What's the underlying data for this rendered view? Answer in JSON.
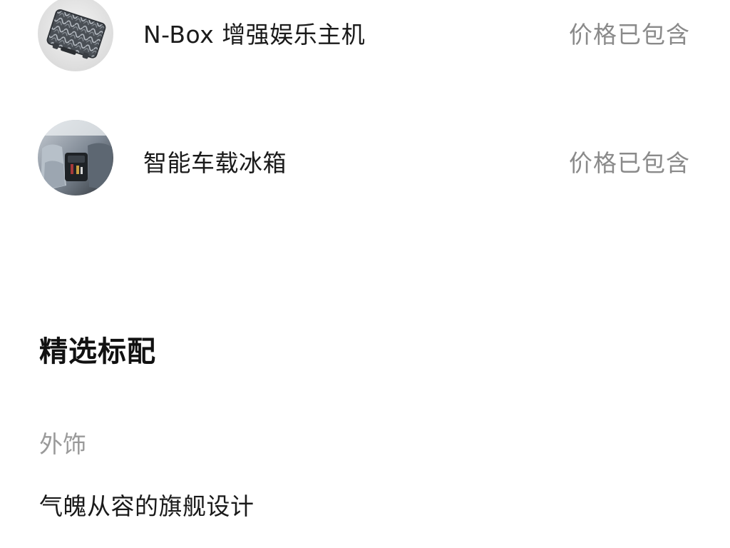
{
  "options": [
    {
      "name": "N-Box 增强娱乐主机",
      "price": "价格已包含",
      "thumbnail_icon": "entertainment-host-icon"
    },
    {
      "name": "智能车载冰箱",
      "price": "价格已包含",
      "thumbnail_icon": "car-fridge-icon"
    }
  ],
  "section": {
    "title": "精选标配",
    "category": "外饰",
    "feature": "气魄从容的旗舰设计"
  }
}
